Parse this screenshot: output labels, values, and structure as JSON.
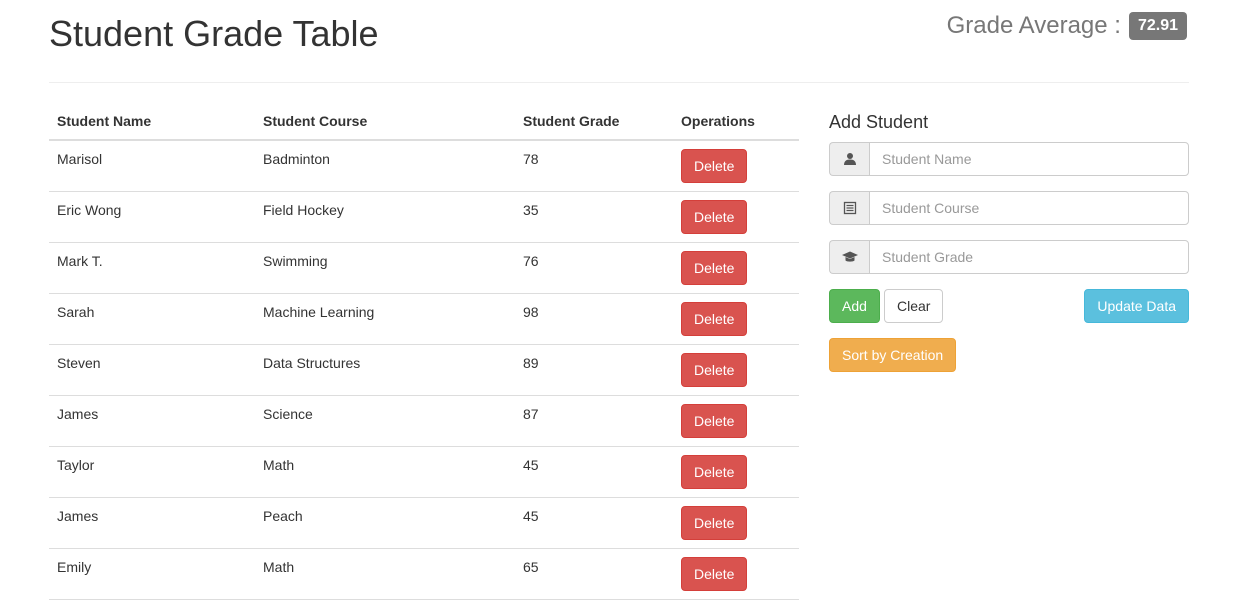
{
  "header": {
    "title": "Student Grade Table",
    "average_label": "Grade Average :",
    "average_value": "72.91"
  },
  "table": {
    "headers": [
      "Student Name",
      "Student Course",
      "Student Grade",
      "Operations"
    ],
    "delete_label": "Delete",
    "rows": [
      {
        "name": "Marisol",
        "course": "Badminton",
        "grade": "78"
      },
      {
        "name": "Eric Wong",
        "course": "Field Hockey",
        "grade": "35"
      },
      {
        "name": "Mark T.",
        "course": "Swimming",
        "grade": "76"
      },
      {
        "name": "Sarah",
        "course": "Machine Learning",
        "grade": "98"
      },
      {
        "name": "Steven",
        "course": "Data Structures",
        "grade": "89"
      },
      {
        "name": "James",
        "course": "Science",
        "grade": "87"
      },
      {
        "name": "Taylor",
        "course": "Math",
        "grade": "45"
      },
      {
        "name": "James",
        "course": "Peach",
        "grade": "45"
      },
      {
        "name": "Emily",
        "course": "Math",
        "grade": "65"
      }
    ]
  },
  "form": {
    "title": "Add Student",
    "fields": [
      {
        "icon": "user-icon",
        "placeholder": "Student Name",
        "value": ""
      },
      {
        "icon": "list-icon",
        "placeholder": "Student Course",
        "value": ""
      },
      {
        "icon": "graduation-cap-icon",
        "placeholder": "Student Grade",
        "value": ""
      }
    ],
    "add_label": "Add",
    "clear_label": "Clear",
    "update_label": "Update Data",
    "sort_label": "Sort by Creation"
  },
  "colors": {
    "danger": "#d9534f",
    "success": "#5cb85c",
    "info": "#5bc0de",
    "warning": "#f0ad4e",
    "badge": "#777777"
  }
}
